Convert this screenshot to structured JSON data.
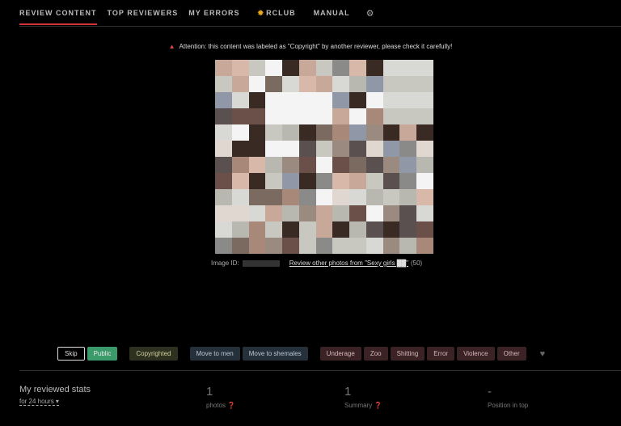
{
  "nav": {
    "tabs": [
      {
        "label": "REVIEW CONTENT",
        "active": true
      },
      {
        "label": "TOP REVIEWERS"
      },
      {
        "label": "MY ERRORS"
      },
      {
        "label": "RCLUB",
        "icon": "star-icon"
      },
      {
        "label": "MANUAL"
      }
    ],
    "settings_icon": "gear-icon"
  },
  "alert": {
    "icon": "warning-icon",
    "text": "Attention: this content was labeled as \"Copyright\" by another reviewer, please check it carefully!"
  },
  "image_meta": {
    "id_label": "Image ID:",
    "review_link": "Review other photos from \"Sexy girls ██\"",
    "count": "(50)"
  },
  "actions": {
    "skip": "Skip",
    "public": "Public",
    "copyrighted": "Copyrighted",
    "move_men": "Move to men",
    "move_shemales": "Move to shemales",
    "flags": [
      "Underage",
      "Zoo",
      "Shitting",
      "Error",
      "Violence",
      "Other"
    ],
    "favorite_icon": "heart-icon"
  },
  "stats": {
    "title": "My reviewed stats",
    "period": "for 24 hours",
    "items": [
      {
        "value": "1",
        "label": "photos",
        "help": "?"
      },
      {
        "value": "1",
        "label": "Summary",
        "help": "?"
      },
      {
        "value": "-",
        "label": "Position in top"
      }
    ]
  },
  "colors": {
    "accent": "#d0343a",
    "public": "#3b9a6a"
  }
}
